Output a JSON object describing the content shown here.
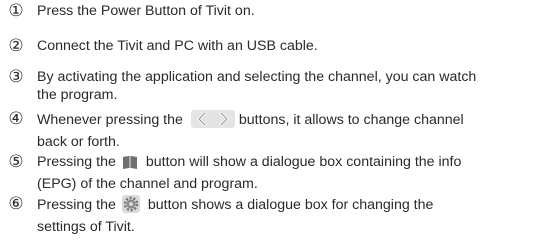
{
  "steps": [
    {
      "num": "①",
      "text": "Press the Power Button of Tivit on."
    },
    {
      "num": "②",
      "text": "Connect the Tivit and PC with an USB cable."
    },
    {
      "num": "③",
      "line1": "By activating the application and selecting the channel, you can watch",
      "line2": "the program."
    },
    {
      "num": "④",
      "line1_before": "Whenever pressing the",
      "line1_after": "buttons, it allows to change channel",
      "line2": "back or forth.",
      "icon": "prev-next-arrows-icon"
    },
    {
      "num": "⑤",
      "line1_before": "Pressing the",
      "line1_after": "button will show a dialogue box containing the info",
      "line2": "(EPG) of the channel and program.",
      "icon": "book-icon"
    },
    {
      "num": "⑥",
      "line1_before": "Pressing the",
      "line1_after": "button shows a dialogue box for changing the",
      "line2": "settings of Tivit.",
      "icon": "gear-icon"
    }
  ],
  "colors": {
    "text": "#2a2a2a",
    "icon_grey": "#6f6f6f",
    "nav_bg": "#e4e4e4"
  }
}
